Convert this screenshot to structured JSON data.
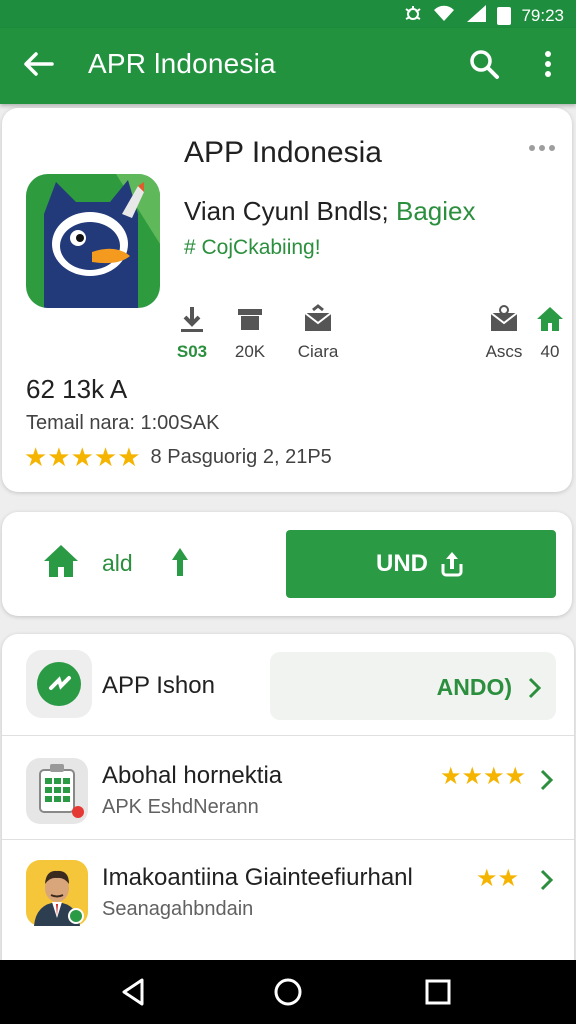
{
  "status": {
    "time": "79:23"
  },
  "appbar": {
    "title": "APR lndonesia"
  },
  "app": {
    "name": "APP Indonesia",
    "developer": "Vian Cyunl Bndls;",
    "category": "Bagiex",
    "tag": "# CojCkabiing!",
    "stats": [
      {
        "icon": "download-icon",
        "label": "S03"
      },
      {
        "icon": "archive-icon",
        "label": "20K"
      },
      {
        "icon": "mail-icon",
        "label": "Ciara"
      },
      {
        "icon": "mail-icon",
        "label": "Ascs"
      },
      {
        "icon": "home-icon",
        "label": "40"
      }
    ],
    "size": "62 13k A",
    "meta": "Temail nara: 1:00SAK",
    "rating_text": "8 Pasguorig 2, 21P5",
    "star_count": 5
  },
  "action": {
    "secondary_label": "ald",
    "install_label": "UND"
  },
  "list": {
    "header": {
      "title": "APP Ishon",
      "pill": "ANDO)"
    },
    "items": [
      {
        "title": "Abohal hornektia",
        "subtitle": "APK EshdNerann",
        "stars": "★★★★"
      },
      {
        "title": "Imakoantiina Giainteefiurhanl",
        "subtitle": "Seanagahbndain",
        "stars": "★★"
      }
    ]
  },
  "colors": {
    "primary": "#22923f",
    "accent_star": "#f4b400",
    "text_green": "#2b8f3e"
  }
}
